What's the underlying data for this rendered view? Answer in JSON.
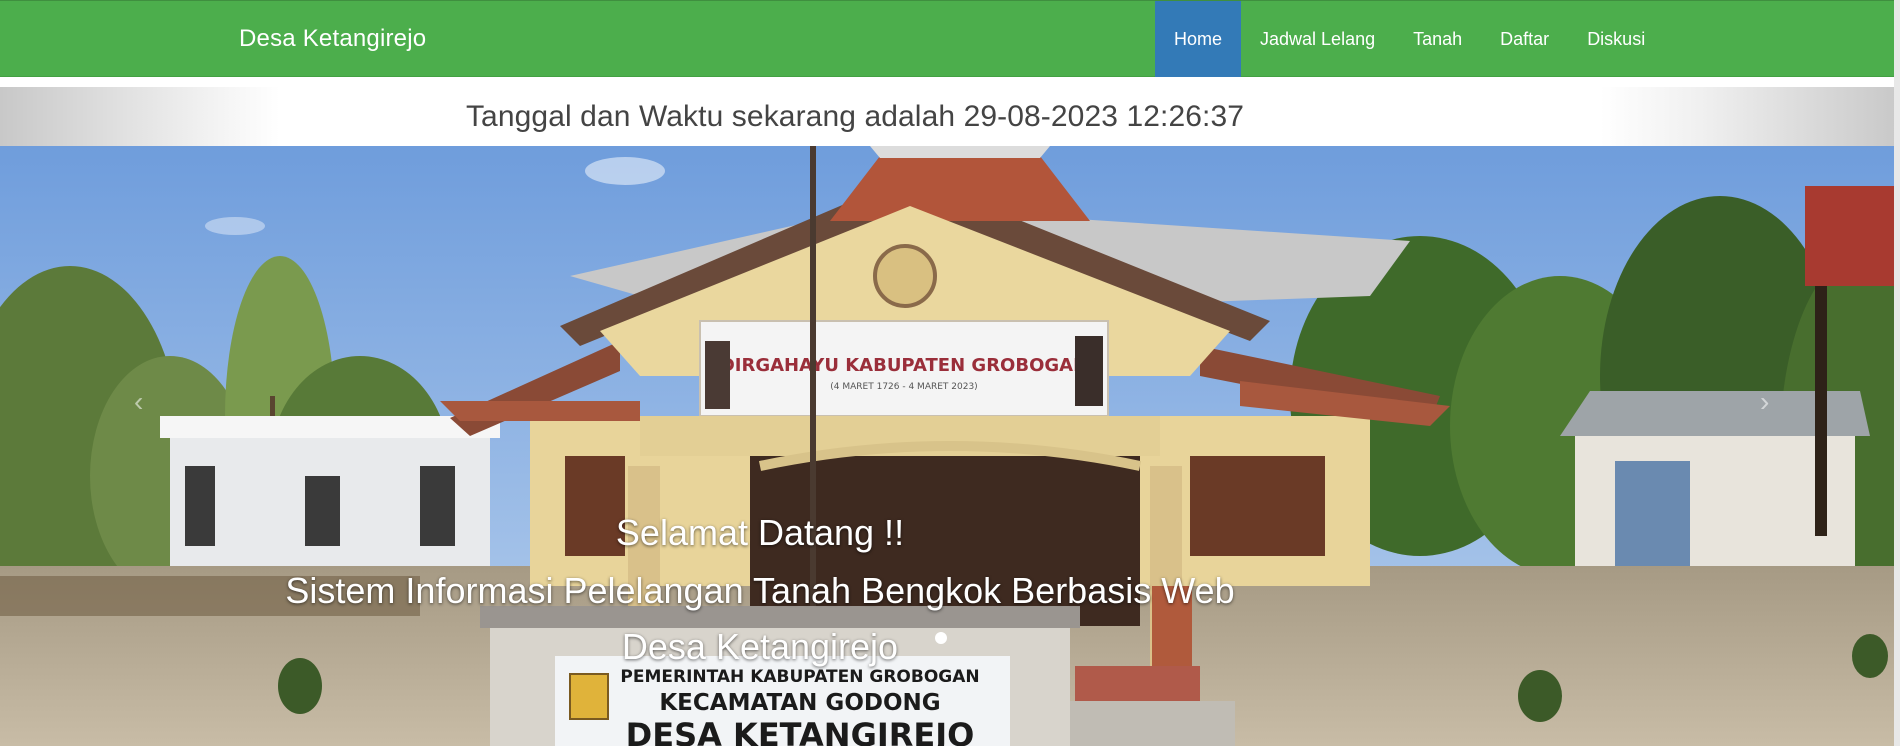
{
  "navbar": {
    "brand": "Desa Ketangirejo",
    "items": [
      {
        "label": "Home",
        "active": true
      },
      {
        "label": "Jadwal Lelang",
        "active": false
      },
      {
        "label": "Tanah",
        "active": false
      },
      {
        "label": "Daftar",
        "active": false
      },
      {
        "label": "Diskusi",
        "active": false
      }
    ],
    "color": "#4cae4c",
    "active_color": "#337ab7"
  },
  "datebar": {
    "text": "Tanggal dan Waktu sekarang adalah 29-08-2023 12:26:37"
  },
  "hero": {
    "caption_line1": "Selamat Datang !!",
    "caption_line2": "Sistem Informasi Pelelangan Tanah Bengkok Berbasis Web",
    "caption_line3": "Desa Ketangirejo",
    "control_prev": "‹",
    "control_next": "›",
    "image_signage": {
      "banner_text": "DIRGAHAYU KABUPATEN GROBOGAN",
      "banner_sub": "(4 MARET 1726 - 4 MARET 2023)",
      "sign_line1": "PEMERINTAH KABUPATEN GROBOGAN",
      "sign_line2": "KECAMATAN GODONG",
      "sign_line3": "DESA KETANGIREJO"
    }
  }
}
